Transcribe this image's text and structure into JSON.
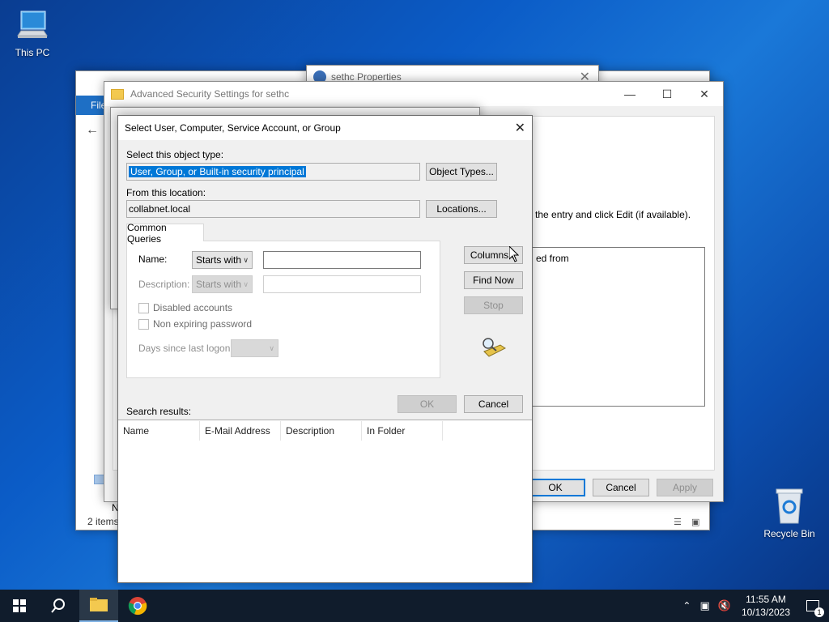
{
  "desktop": {
    "this_pc_label": "This PC",
    "recycle_bin_label": "Recycle Bin"
  },
  "explorer": {
    "file_tab": "File",
    "status_items": "2 items",
    "nav_partial": "N"
  },
  "sethc_props": {
    "title": "sethc Properties"
  },
  "adv_security": {
    "title": "Advanced Security Settings for sethc",
    "instruction_partial": "the entry and click Edit (if available).",
    "list_partial": "ed from",
    "ok": "OK",
    "cancel": "Cancel",
    "apply": "Apply"
  },
  "select_dialog": {
    "title": "Select User, Computer, Service Account, or Group",
    "object_type_label": "Select this object type:",
    "object_type_value": "User, Group, or Built-in security principal",
    "object_types_button": "Object Types...",
    "location_label": "From this location:",
    "location_value": "collabnet.local",
    "locations_button": "Locations...",
    "tab_common_queries": "Common Queries",
    "name_label": "Name:",
    "name_mode": "Starts with",
    "description_label": "Description:",
    "description_mode": "Starts with",
    "disabled_accounts": "Disabled accounts",
    "non_expiring_password": "Non expiring password",
    "days_since_logon": "Days since last logon:",
    "columns_button": "Columns...",
    "find_now_button": "Find Now",
    "stop_button": "Stop",
    "ok_button": "OK",
    "cancel_button": "Cancel",
    "search_results_label": "Search results:",
    "columns": [
      "Name",
      "E-Mail Address",
      "Description",
      "In Folder"
    ]
  },
  "taskbar": {
    "time": "11:55 AM",
    "date": "10/13/2023",
    "notification_count": "1"
  },
  "colors": {
    "accent": "#0078d7",
    "selection": "#0078d7",
    "taskbar": "#101c2c"
  }
}
